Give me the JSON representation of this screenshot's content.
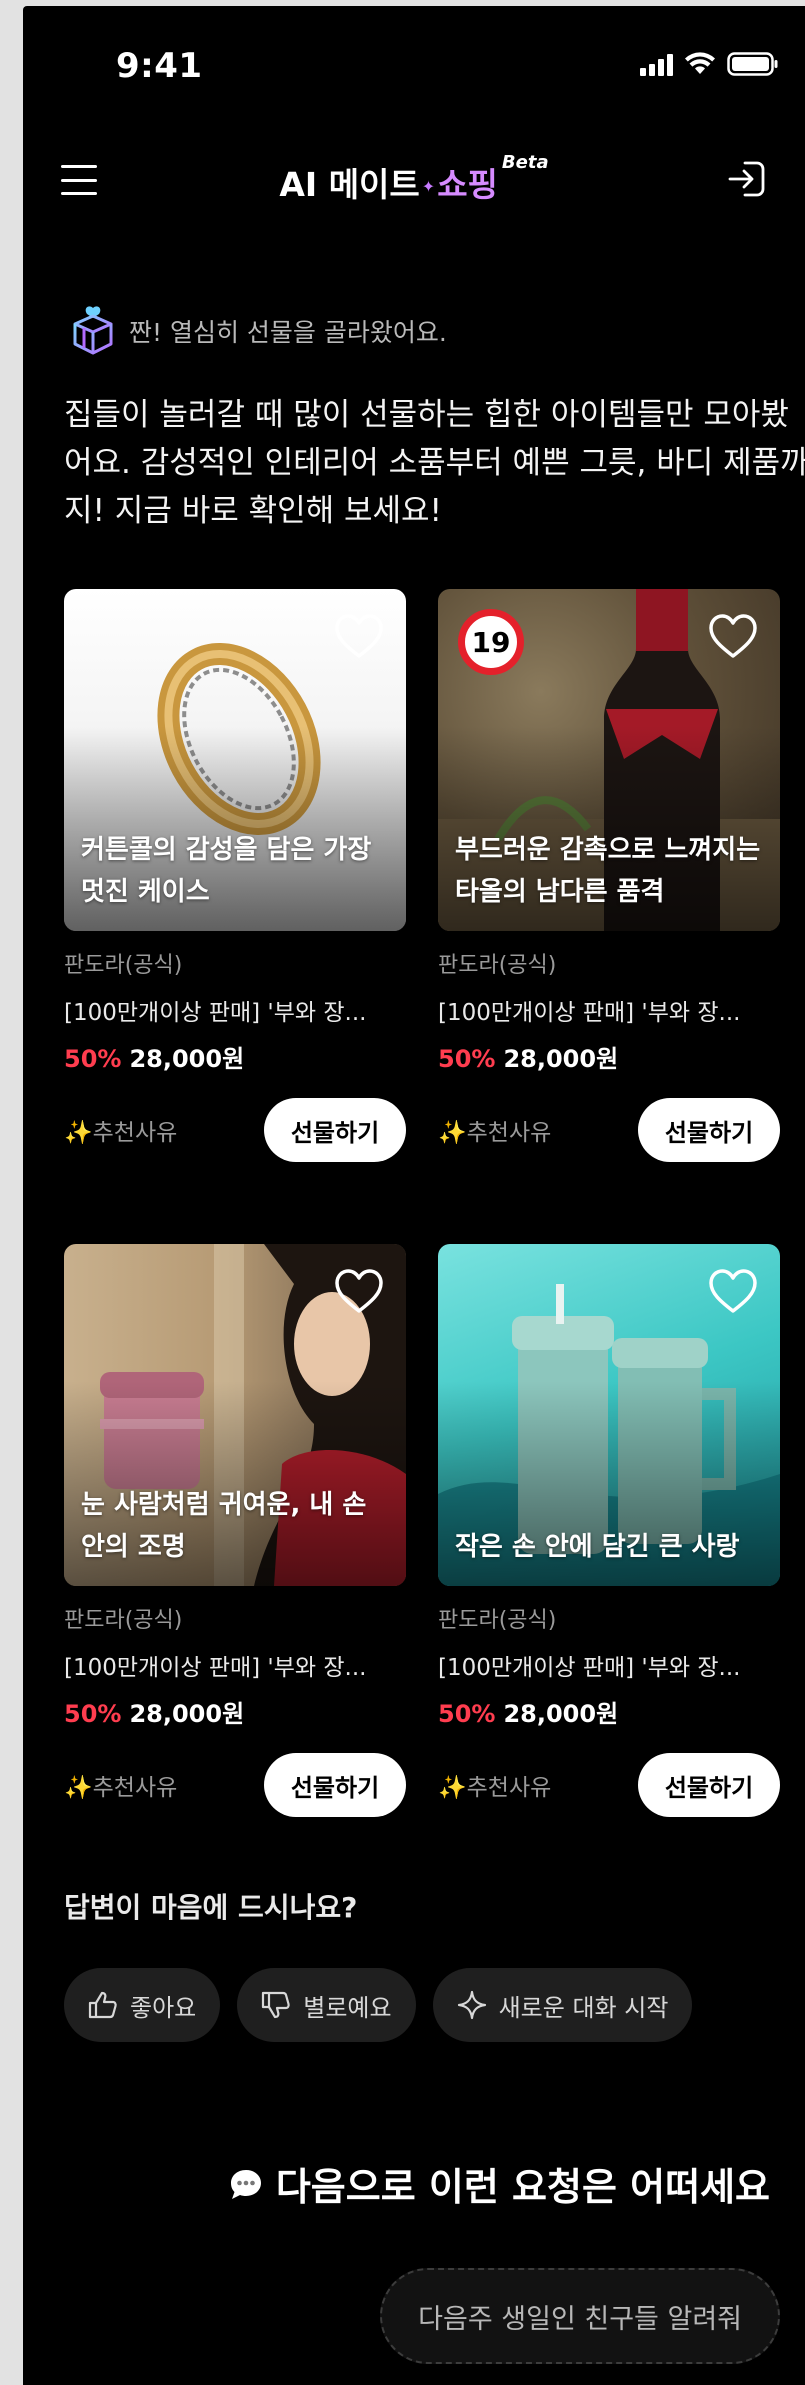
{
  "status_bar": {
    "time": "9:41"
  },
  "header": {
    "logo_main": "AI 메이트",
    "logo_sparkle": "✦",
    "logo_accent": "쇼핑",
    "logo_badge": "Beta"
  },
  "intro": {
    "subtitle": "짠! 열심히 선물을 골라왔어요.",
    "message": "집들이 놀러갈 때 많이 선물하는 힙한 아이템들만 모아봤어요. 감성적인 인테리어 소품부터 예쁜 그릇, 바디 제품까지! 지금 바로 확인해 보세요!"
  },
  "products": [
    {
      "caption": "커튼콜의 감성을 담은 가장 멋진 케이스",
      "brand": "판도라(공식)",
      "name": "[100만개이상 판매] '부와 장...",
      "discount": "50%",
      "price": "28,000원",
      "reason": "추천사유",
      "reason_icon": "✨",
      "action": "선물하기",
      "image": "ring",
      "age_badge": ""
    },
    {
      "caption": "부드러운 감촉으로 느껴지는 타올의 남다른 품격",
      "brand": "판도라(공식)",
      "name": "[100만개이상 판매] '부와 장...",
      "discount": "50%",
      "price": "28,000원",
      "reason": "추천사유",
      "reason_icon": "✨",
      "action": "선물하기",
      "image": "wine",
      "age_badge": "19"
    },
    {
      "caption": "눈 사람처럼 귀여운, 내 손 안의 조명",
      "brand": "판도라(공식)",
      "name": "[100만개이상 판매] '부와 장...",
      "discount": "50%",
      "price": "28,000원",
      "reason": "추천사유",
      "reason_icon": "✨",
      "action": "선물하기",
      "image": "cosmetic",
      "age_badge": ""
    },
    {
      "caption": "작은 손 안에 담긴 큰 사랑",
      "brand": "판도라(공식)",
      "name": "[100만개이상 판매] '부와 장...",
      "discount": "50%",
      "price": "28,000원",
      "reason": "추천사유",
      "reason_icon": "✨",
      "action": "선물하기",
      "image": "tumbler",
      "age_badge": ""
    }
  ],
  "feedback": {
    "question": "답변이 마음에 드시나요?",
    "like": "좋아요",
    "dislike": "별로예요",
    "new_chat": "새로운 대화 시작"
  },
  "next": {
    "title": "다음으로 이런 요청은 어떠세요",
    "suggestion": "다음주 생일인 친구들 알려줘"
  },
  "colors": {
    "accent": "#d68bff",
    "discount": "#ff3d4f",
    "background": "#000000",
    "age_badge_ring": "#e4212b"
  }
}
